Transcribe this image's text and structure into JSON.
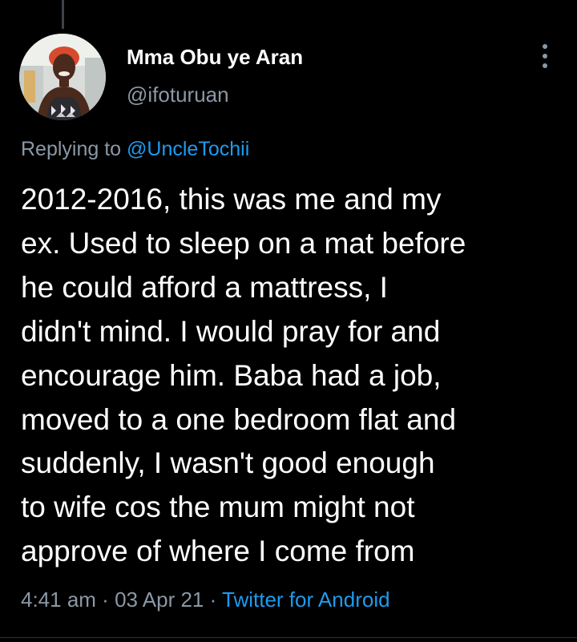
{
  "tweet": {
    "author": {
      "display_name": "Mma Obu ye Aran",
      "handle": "@ifoturuan"
    },
    "replying_prefix": "Replying to ",
    "replying_to": "@UncleTochii",
    "text_lines": [
      "2012-2016, this was me and my",
      "ex. Used to sleep on a mat before",
      "he could afford a mattress, I",
      "didn't mind. I would pray for and",
      "encourage him. Baba had a job,",
      "moved to a one bedroom flat and",
      "suddenly, I wasn't good enough",
      "to wife cos the mum might not",
      "approve of where I come from"
    ],
    "time": "4:41 am",
    "date": "03 Apr 21",
    "separator": " · ",
    "source": "Twitter for Android"
  },
  "icons": {
    "more": "more-vertical-icon",
    "avatar": "profile-photo"
  },
  "colors": {
    "background": "#000000",
    "primary_text": "#ffffff",
    "secondary_text": "#8b98a5",
    "accent": "#1d9bf0"
  }
}
